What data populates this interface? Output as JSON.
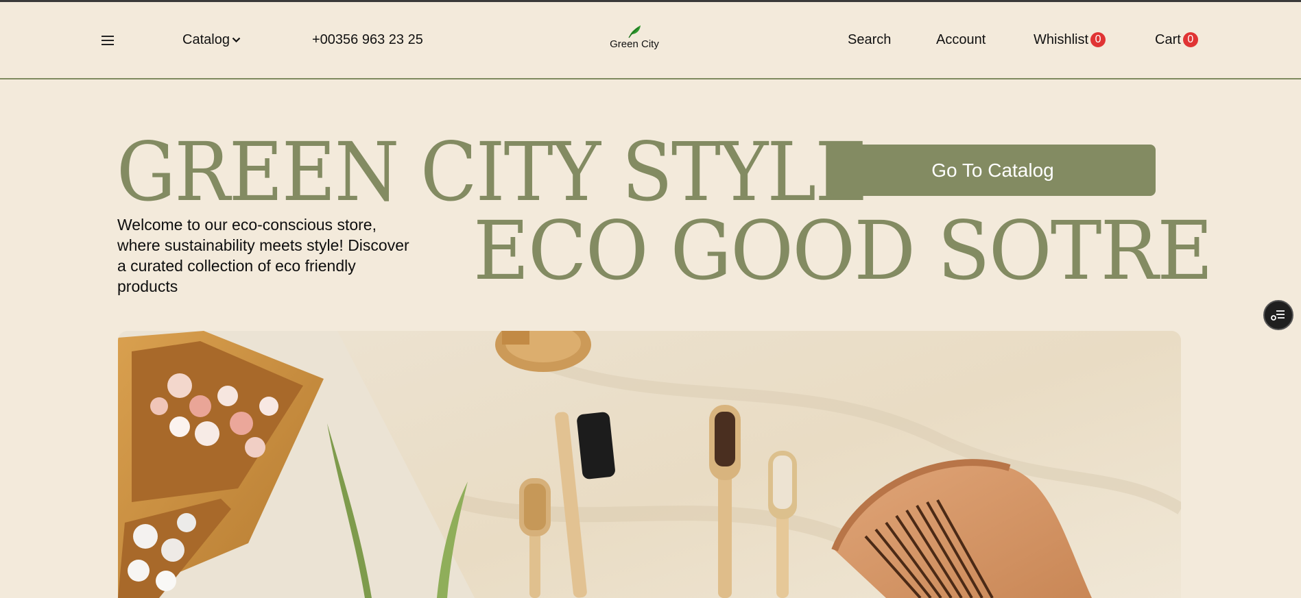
{
  "header": {
    "menu_icon": "hamburger-menu-icon",
    "catalog_label": "Catalog",
    "phone": "+00356 963 23 25",
    "logo_text": "Green City",
    "search_label": "Search",
    "account_label": "Account",
    "wishlist_label": "Whishlist",
    "wishlist_count": "0",
    "cart_label": "Cart",
    "cart_count": "0"
  },
  "hero": {
    "title_line1": "GREEN CITY STYLE",
    "title_line2": "ECO GOOD SOTRE",
    "cta_label": "Go To Catalog",
    "intro": "Welcome to our eco-conscious store, where sustainability meets style! Discover a curated collection of eco friendly products",
    "image": "hero-image-eco-products"
  },
  "floating": {
    "icon": "settings-list-icon"
  },
  "colors": {
    "background": "#f3eadb",
    "accent": "#838b62",
    "badge": "#e03434"
  }
}
